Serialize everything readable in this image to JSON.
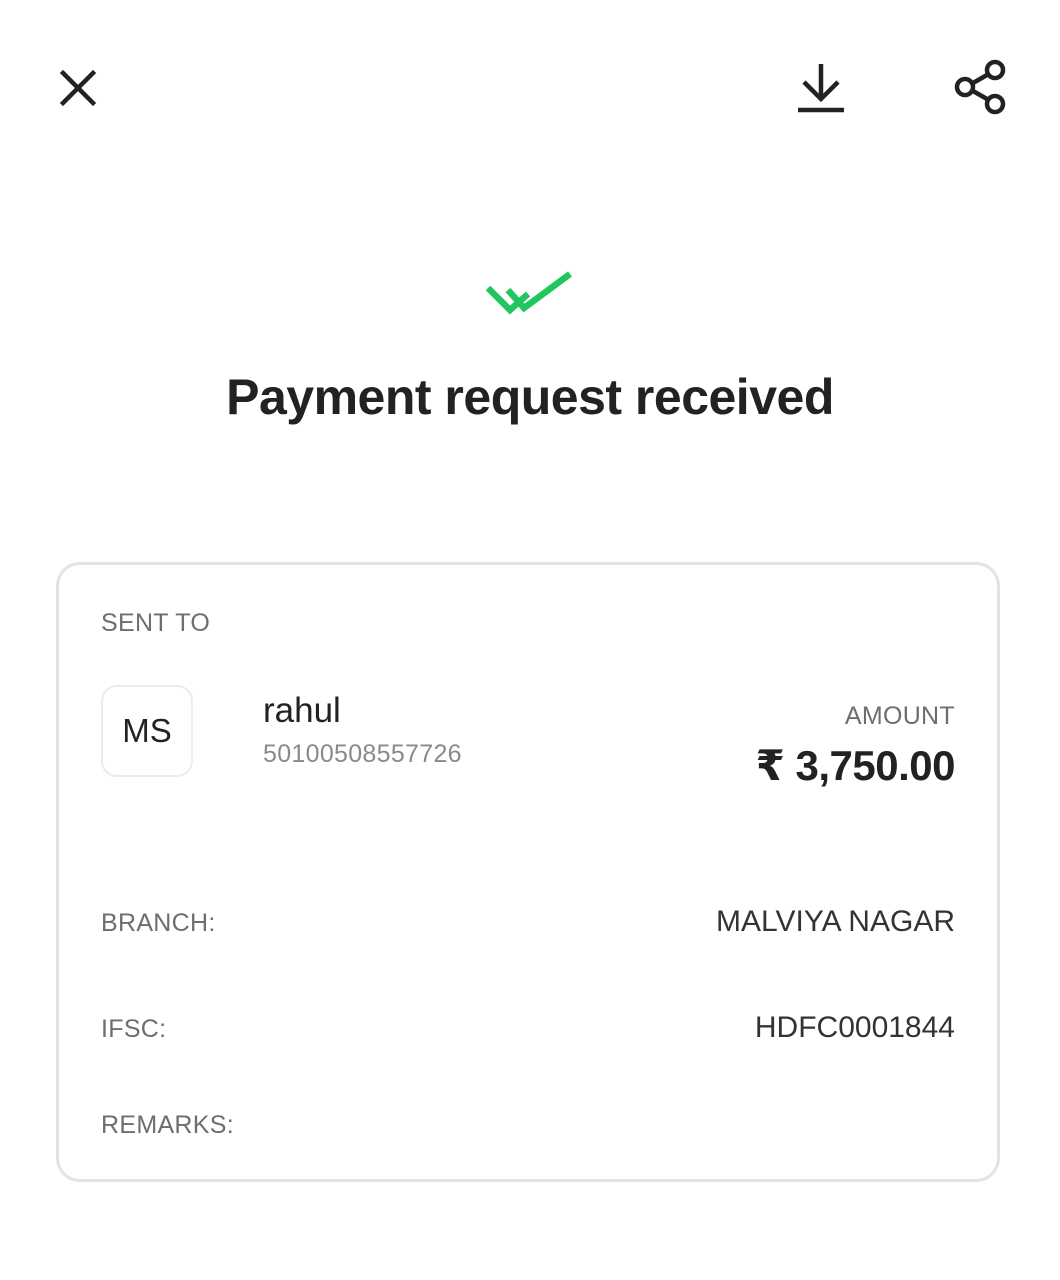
{
  "header": {
    "close_icon": "close-icon",
    "download_icon": "download-icon",
    "share_icon": "share-icon"
  },
  "status": {
    "icon": "double-check-icon",
    "icon_color": "#22c55e",
    "title": "Payment request received"
  },
  "card": {
    "sent_to_label": "SENT TO",
    "recipient": {
      "initials": "MS",
      "name": "rahul",
      "account_number": "50100508557726"
    },
    "amount_label": "AMOUNT",
    "amount_value": "₹ 3,750.00",
    "details": {
      "branch_label": "BRANCH:",
      "branch_value": "MALVIYA NAGAR",
      "ifsc_label": "IFSC:",
      "ifsc_value": "HDFC0001844",
      "remarks_label": "REMARKS:"
    }
  }
}
